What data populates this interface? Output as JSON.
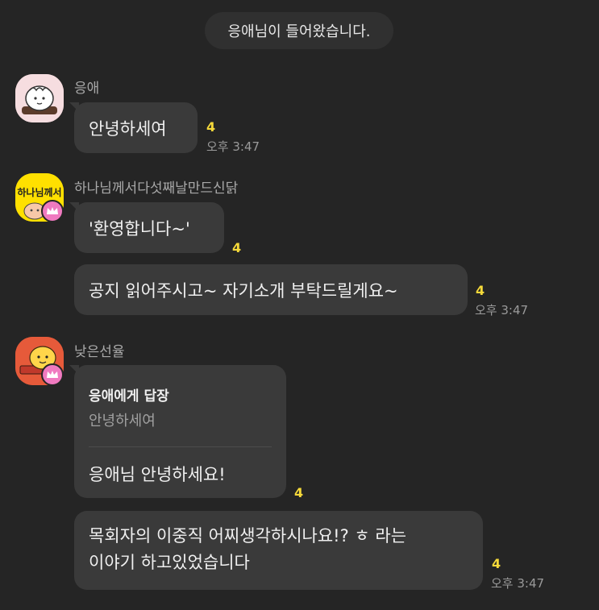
{
  "system_message": "응애님이 들어왔습니다.",
  "colors": {
    "background": "#252525",
    "bubble": "#3a3a3a",
    "unread_count": "#f5d93a",
    "crown_badge": "#f07ac0"
  },
  "messages": [
    {
      "sender": "응애",
      "avatar_icon": "sheep-character-avatar",
      "bubbles": [
        {
          "text": "안녕하세여",
          "count": "4",
          "time": "오후 3:47"
        }
      ]
    },
    {
      "sender": "하나님께서다섯째날만드신닭",
      "avatar_icon": "yellow-chick-avatar",
      "avatar_text": "하나님께서",
      "bubbles": [
        {
          "text": "'환영합니다~'",
          "count": "4"
        },
        {
          "text": "공지 읽어주시고~ 자기소개 부탁드릴게요~",
          "count": "4",
          "time": "오후 3:47"
        }
      ]
    },
    {
      "sender": "낮은선율",
      "avatar_icon": "orange-character-avatar",
      "bubbles": [
        {
          "reply_to": "응애에게 답장",
          "reply_quote": "안녕하세여",
          "text": "응애님 안녕하세요!",
          "count": "4"
        },
        {
          "text_line1": "목회자의 이중직 어찌생각하시나요!? ㅎ 라는",
          "text_line2": "이야기 하고있었습니다",
          "count": "4",
          "time": "오후 3:47"
        }
      ]
    }
  ]
}
